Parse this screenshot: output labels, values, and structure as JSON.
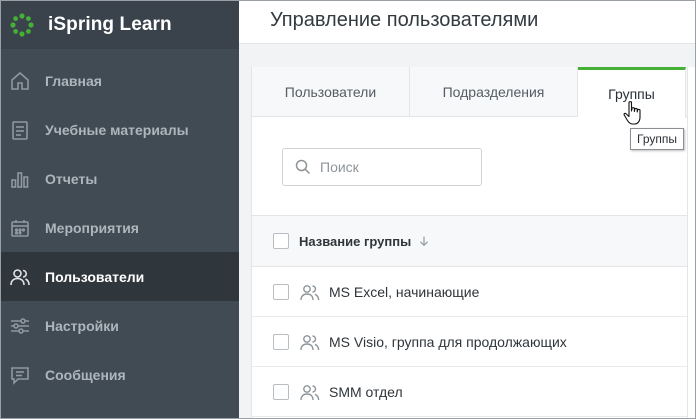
{
  "app": {
    "name": "iSpring Learn",
    "accent_color": "#44b035",
    "sidebar_bg": "#414b54"
  },
  "sidebar": {
    "items": [
      {
        "label": "Главная",
        "icon": "home-icon",
        "active": false
      },
      {
        "label": "Учебные материалы",
        "icon": "document-icon",
        "active": false
      },
      {
        "label": "Отчеты",
        "icon": "bar-chart-icon",
        "active": false
      },
      {
        "label": "Мероприятия",
        "icon": "calendar-icon",
        "active": false
      },
      {
        "label": "Пользователи",
        "icon": "users-icon",
        "active": true
      },
      {
        "label": "Настройки",
        "icon": "sliders-icon",
        "active": false
      },
      {
        "label": "Сообщения",
        "icon": "message-icon",
        "active": false
      }
    ]
  },
  "header": {
    "title": "Управление пользователями"
  },
  "tabs": [
    {
      "label": "Пользователи",
      "active": false
    },
    {
      "label": "Подразделения",
      "active": false
    },
    {
      "label": "Группы",
      "active": true
    }
  ],
  "search": {
    "placeholder": "Поиск",
    "value": ""
  },
  "table": {
    "column_header": "Название группы",
    "rows": [
      {
        "name": "MS Excel, начинающие"
      },
      {
        "name": "MS Visio, группа для продолжающих"
      },
      {
        "name": "SMM отдел"
      }
    ]
  },
  "tooltip": {
    "text": "Группы"
  }
}
